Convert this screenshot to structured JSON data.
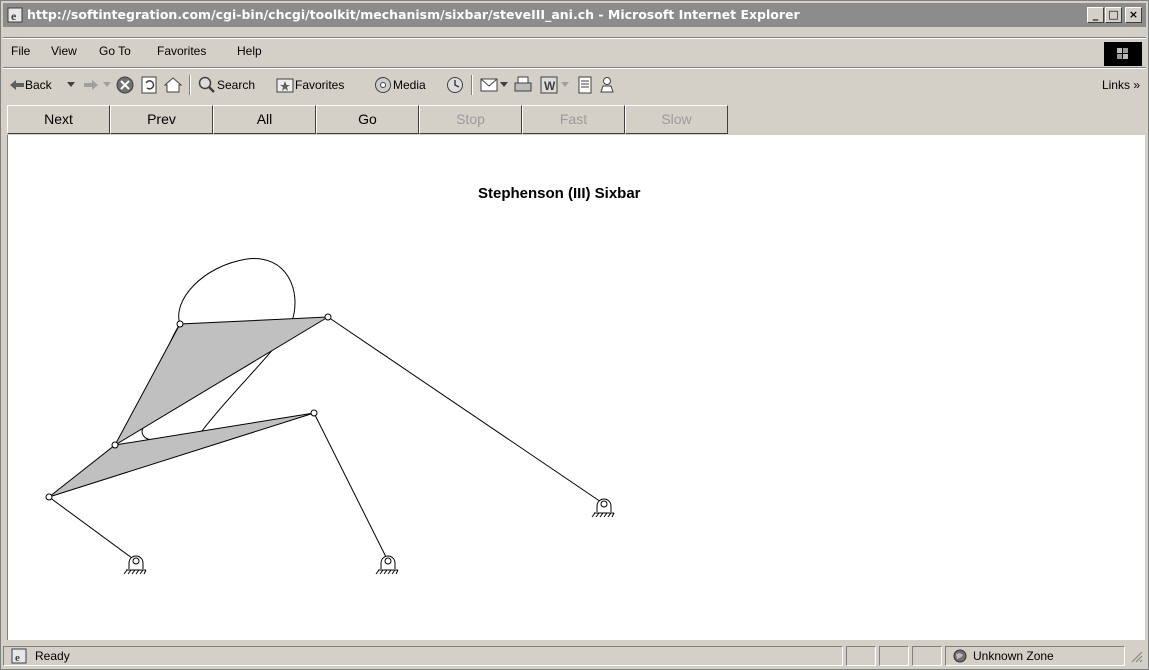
{
  "window": {
    "title": "http://softintegration.com/cgi-bin/chcgi/toolkit/mechanism/sixbar/steveIII_ani.ch - Microsoft Internet Explorer",
    "minimize": "_",
    "maximize": "□",
    "close": "×"
  },
  "menu": {
    "items": [
      "File",
      "View",
      "Go To",
      "Favorites",
      "Help"
    ]
  },
  "toolbar": {
    "back": "Back",
    "search": "Search",
    "favorites": "Favorites",
    "media": "Media",
    "links": "Links"
  },
  "navbar": {
    "buttons": [
      {
        "label": "Next",
        "enabled": true
      },
      {
        "label": "Prev",
        "enabled": true
      },
      {
        "label": "All",
        "enabled": true
      },
      {
        "label": "Go",
        "enabled": true
      },
      {
        "label": "Stop",
        "enabled": false
      },
      {
        "label": "Fast",
        "enabled": false
      },
      {
        "label": "Slow",
        "enabled": false
      }
    ]
  },
  "page": {
    "title": "Stephenson (III) Sixbar"
  },
  "status": {
    "text": "Ready",
    "zone": "Unknown Zone"
  },
  "colors": {
    "link_fill": "#c0c0c0",
    "titlebar": "#8c8c8c"
  }
}
